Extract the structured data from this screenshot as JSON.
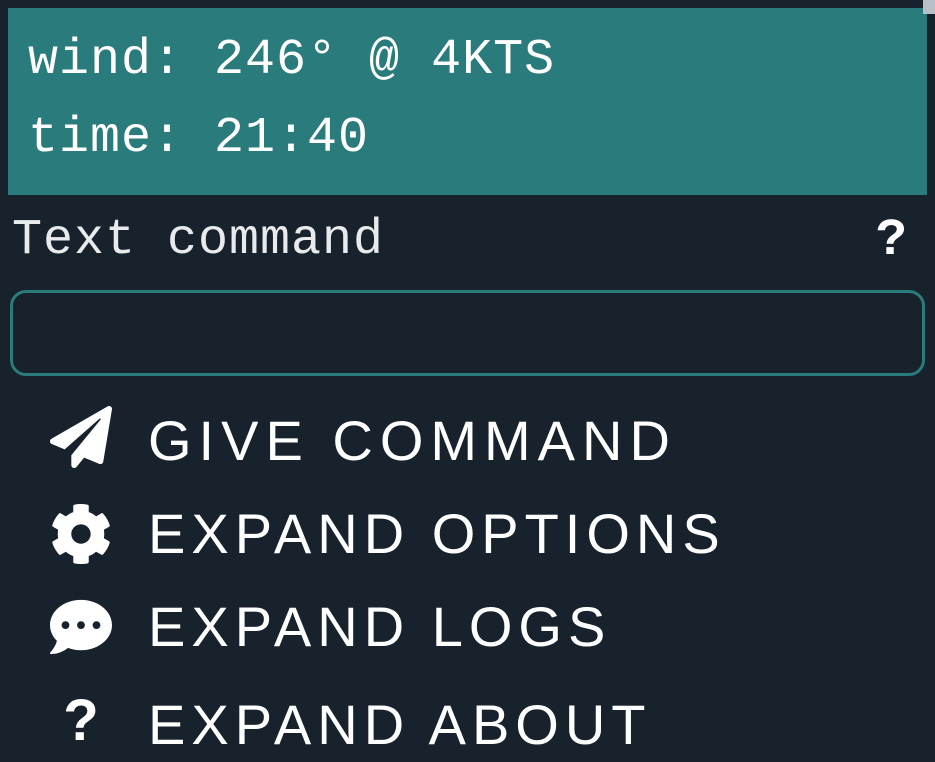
{
  "status": {
    "wind_line": "wind: 246° @ 4KTS",
    "time_line": "time: 21:40"
  },
  "command": {
    "label": "Text command",
    "help_symbol": "?",
    "input_value": ""
  },
  "menu": {
    "give_command": "GIVE COMMAND",
    "expand_options": "EXPAND OPTIONS",
    "expand_logs": "EXPAND LOGS",
    "expand_about": "EXPAND ABOUT"
  },
  "icons": {
    "send": "paper-plane",
    "options": "gear",
    "logs": "chat-bubble",
    "about": "question-mark"
  }
}
